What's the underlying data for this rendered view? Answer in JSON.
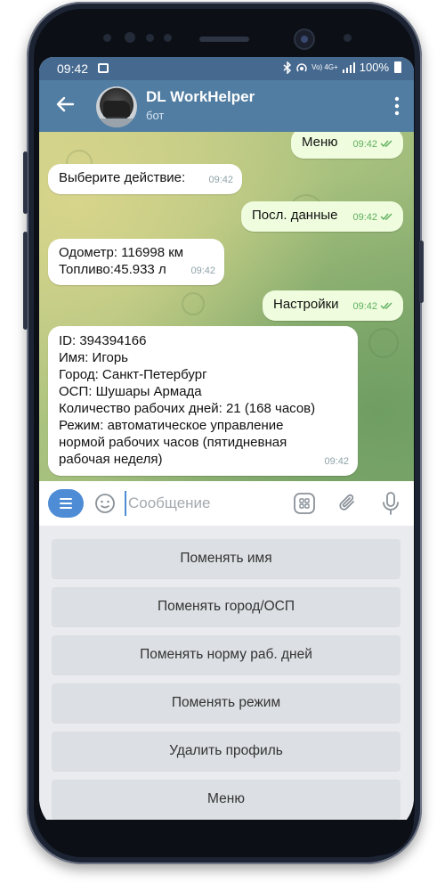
{
  "status_bar": {
    "time": "09:42",
    "network_label": "Vo) 4G+",
    "battery": "100%"
  },
  "app_bar": {
    "title": "DL WorkHelper",
    "subtitle": "бот"
  },
  "messages": [
    {
      "direction": "out",
      "text": "Меню",
      "time": "09:42"
    },
    {
      "direction": "in",
      "text": "Выберите действие:",
      "time": "09:42"
    },
    {
      "direction": "out",
      "text": "Посл. данные",
      "time": "09:42"
    },
    {
      "direction": "in",
      "text": "Одометр: 116998 км\nТопливо:45.933 л",
      "time": "09:42"
    },
    {
      "direction": "out",
      "text": "Настройки",
      "time": "09:42"
    },
    {
      "direction": "in",
      "text": "ID: 394394166\nИмя: Игорь\nГород: Санкт-Петербург\nОСП: Шушары Армада\nКоличество рабочих дней: 21 (168 часов)\nРежим: автоматическое управление\nнормой рабочих часов (пятидневная\nрабочая неделя)",
      "time": "09:42"
    }
  ],
  "input": {
    "placeholder": "Сообщение"
  },
  "keyboard": {
    "buttons": [
      "Поменять имя",
      "Поменять город/ОСП",
      "Поменять норму раб. дней",
      "Поменять режим",
      "Удалить профиль",
      "Меню"
    ]
  },
  "colors": {
    "header": "#517da2",
    "status_bar": "#46698f",
    "outgoing_bubble": "#effdde",
    "incoming_bubble": "#ffffff",
    "accent": "#4e8dd6"
  }
}
